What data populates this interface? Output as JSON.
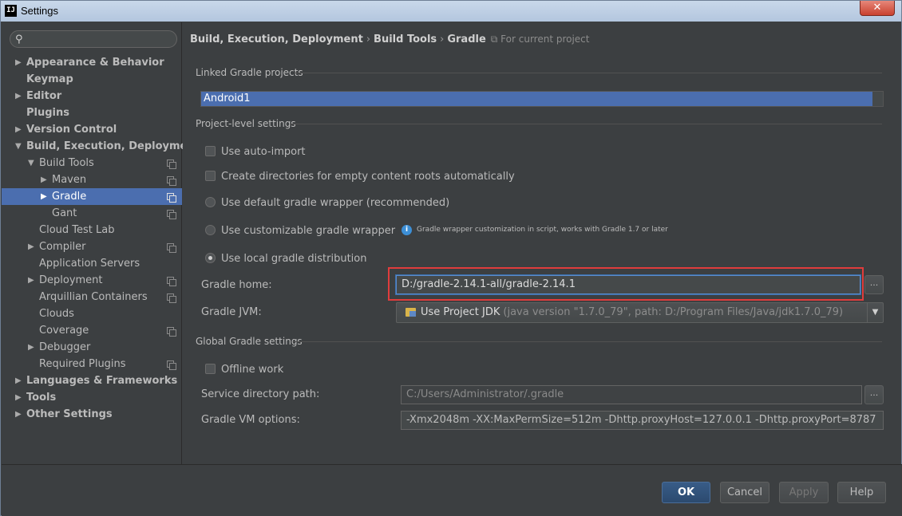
{
  "window": {
    "title": "Settings",
    "app_icon": "IJ",
    "close": "✕"
  },
  "search": {
    "placeholder": "",
    "icon": "search-icon"
  },
  "tree": [
    {
      "label": "Appearance & Behavior",
      "bold": true,
      "arrow": "▶"
    },
    {
      "label": "Keymap",
      "bold": true
    },
    {
      "label": "Editor",
      "bold": true,
      "arrow": "▶"
    },
    {
      "label": "Plugins",
      "bold": true
    },
    {
      "label": "Version Control",
      "bold": true,
      "arrow": "▶"
    },
    {
      "label": "Build, Execution, Deployment",
      "bold": true,
      "arrow": "▼"
    },
    {
      "label": "Build Tools",
      "arrow": "▼",
      "copy": true
    },
    {
      "label": "Maven",
      "arrow": "▶",
      "copy": true
    },
    {
      "label": "Gradle",
      "arrow": "▶",
      "copy": true,
      "selected": true
    },
    {
      "label": "Gant",
      "copy": true
    },
    {
      "label": "Cloud Test Lab"
    },
    {
      "label": "Compiler",
      "arrow": "▶",
      "copy": true
    },
    {
      "label": "Application Servers"
    },
    {
      "label": "Deployment",
      "arrow": "▶",
      "copy": true
    },
    {
      "label": "Arquillian Containers",
      "copy": true
    },
    {
      "label": "Clouds"
    },
    {
      "label": "Coverage",
      "copy": true
    },
    {
      "label": "Debugger",
      "arrow": "▶"
    },
    {
      "label": "Required Plugins",
      "copy": true
    },
    {
      "label": "Languages & Frameworks",
      "bold": true,
      "arrow": "▶"
    },
    {
      "label": "Tools",
      "bold": true,
      "arrow": "▶"
    },
    {
      "label": "Other Settings",
      "bold": true,
      "arrow": "▶"
    }
  ],
  "breadcrumb": {
    "part1": "Build, Execution, Deployment",
    "sep1": "›",
    "part2": "Build Tools",
    "sep2": "›",
    "part3": "Gradle",
    "scope": "For current project"
  },
  "linked": {
    "header": "Linked Gradle projects",
    "selected": "Android1"
  },
  "project": {
    "header": "Project-level settings",
    "auto_import": "Use auto-import",
    "create_dirs": "Create directories for empty content roots automatically",
    "default_wrapper": "Use default gradle wrapper (recommended)",
    "custom_wrapper": "Use customizable gradle wrapper",
    "info_icon": "i",
    "info_text": "Gradle wrapper customization in script, works with Gradle 1.7 or later",
    "local_dist": "Use local gradle distribution",
    "gradle_home_label": "Gradle home:",
    "gradle_home_value": "D:/gradle-2.14.1-all/gradle-2.14.1",
    "browse": "...",
    "jvm_label": "Gradle JVM:",
    "jvm_value": "Use Project JDK",
    "jvm_hint": "(java version \"1.7.0_79\", path: D:/Program Files/Java/jdk1.7.0_79)",
    "jvm_drop": "▼"
  },
  "global": {
    "header": "Global Gradle settings",
    "offline": "Offline work",
    "service_label": "Service directory path:",
    "service_value": "C:/Users/Administrator/.gradle",
    "browse": "...",
    "vm_label": "Gradle VM options:",
    "vm_value": "-Xmx2048m -XX:MaxPermSize=512m -Dhttp.proxyHost=127.0.0.1 -Dhttp.proxyPort=8787"
  },
  "buttons": {
    "ok": "OK",
    "cancel": "Cancel",
    "apply": "Apply",
    "help": "Help"
  },
  "colors": {
    "background": "#3c3f41",
    "selection": "#4b6eaf",
    "highlight": "#e03c3c"
  }
}
